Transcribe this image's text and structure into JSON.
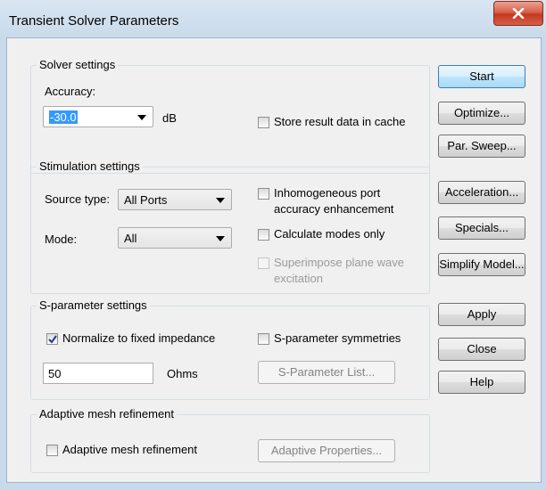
{
  "window": {
    "title": "Transient Solver Parameters",
    "close_icon": "close-icon"
  },
  "solver": {
    "legend": "Solver settings",
    "accuracy_label": "Accuracy:",
    "accuracy_value": "-30.0",
    "accuracy_unit": "dB",
    "store_cache_label": "Store result data in cache",
    "store_cache_checked": false
  },
  "stimulation": {
    "legend": "Stimulation settings",
    "source_type_label": "Source type:",
    "source_type_value": "All Ports",
    "mode_label": "Mode:",
    "mode_value": "All",
    "inhomogeneous_line1": "Inhomogeneous port",
    "inhomogeneous_line2": "accuracy enhancement",
    "inhomogeneous_checked": false,
    "calc_modes_label": "Calculate modes only",
    "calc_modes_checked": false,
    "superimpose_line1": "Superimpose plane wave",
    "superimpose_line2": "excitation",
    "superimpose_checked": false
  },
  "sparam": {
    "legend": "S-parameter settings",
    "normalize_label": "Normalize to fixed impedance",
    "normalize_checked": true,
    "symmetries_label": "S-parameter symmetries",
    "symmetries_checked": false,
    "impedance_value": "50",
    "impedance_unit": "Ohms",
    "list_button": "S-Parameter List..."
  },
  "adaptive": {
    "legend": "Adaptive mesh refinement",
    "checkbox_label": "Adaptive mesh refinement",
    "checked": false,
    "properties_button": "Adaptive Properties..."
  },
  "buttons": {
    "start": "Start",
    "optimize": "Optimize...",
    "par_sweep": "Par. Sweep...",
    "acceleration": "Acceleration...",
    "specials": "Specials...",
    "simplify": "Simplify Model...",
    "apply": "Apply",
    "close": "Close",
    "help": "Help"
  }
}
